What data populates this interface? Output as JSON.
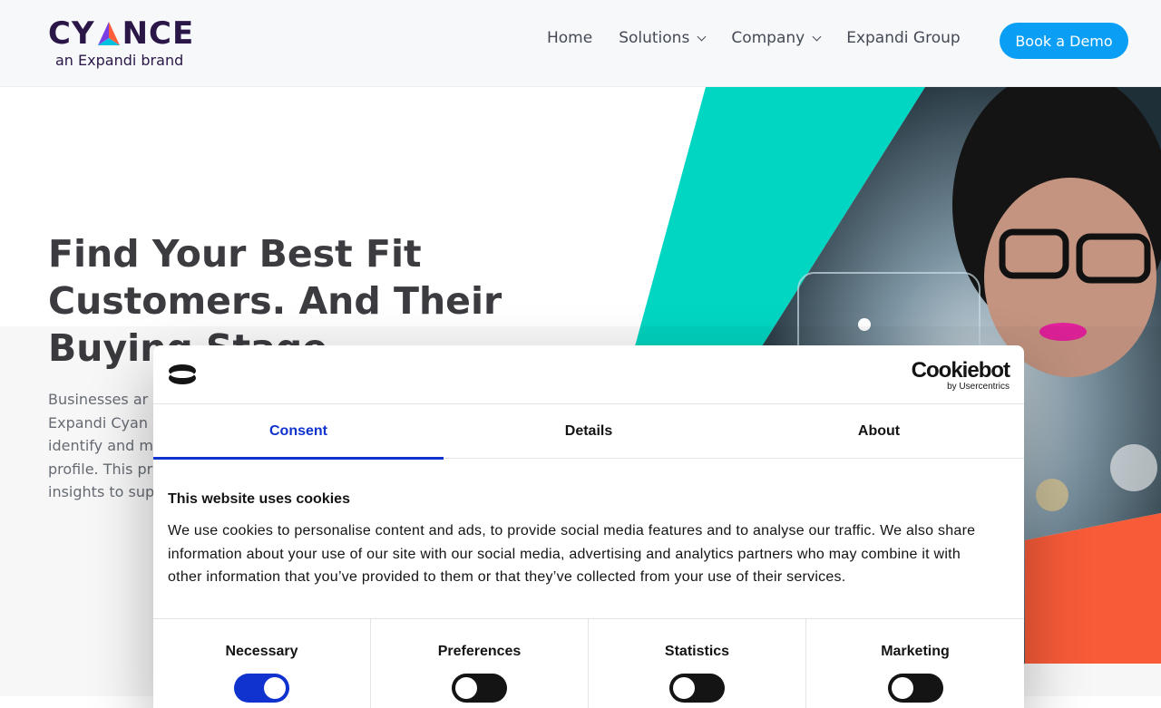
{
  "header": {
    "logo_text": "CYANCE",
    "logo_subtitle": "an Expandi brand",
    "nav": [
      {
        "label": "Home",
        "has_dropdown": false
      },
      {
        "label": "Solutions",
        "has_dropdown": true
      },
      {
        "label": "Company",
        "has_dropdown": true
      },
      {
        "label": "Expandi Group",
        "has_dropdown": false
      }
    ],
    "cta_label": "Book a Demo"
  },
  "hero": {
    "title_lines": [
      "Find Your Best Fit",
      "Customers. And Their",
      "Buying Stage."
    ],
    "body_lines": [
      "Businesses ar",
      "Expandi Cyan",
      "identify and m",
      "profile. This pr",
      "insights to sup"
    ]
  },
  "cookie_dialog": {
    "brand_name": "Cookiebot",
    "brand_by": "by Usercentrics",
    "tabs": [
      {
        "label": "Consent",
        "active": true
      },
      {
        "label": "Details",
        "active": false
      },
      {
        "label": "About",
        "active": false
      }
    ],
    "heading": "This website uses cookies",
    "text_lines": [
      "We use cookies to personalise content and ads, to provide social media features and to analyse our traffic. We also share",
      "information about your use of our site with our social media, advertising and analytics partners who may combine it with",
      "other information that you’ve provided to them or that they’ve collected from your use of their services."
    ],
    "toggles": [
      {
        "label": "Necessary",
        "on": true
      },
      {
        "label": "Preferences",
        "on": false
      },
      {
        "label": "Statistics",
        "on": false
      },
      {
        "label": "Marketing",
        "on": false
      }
    ]
  },
  "colors": {
    "brand_dark": "#2a1747",
    "cta_blue": "#0a9ff5",
    "teal": "#00d6c2",
    "orange": "#ff5e3a",
    "consent_blue": "#1032cf"
  }
}
